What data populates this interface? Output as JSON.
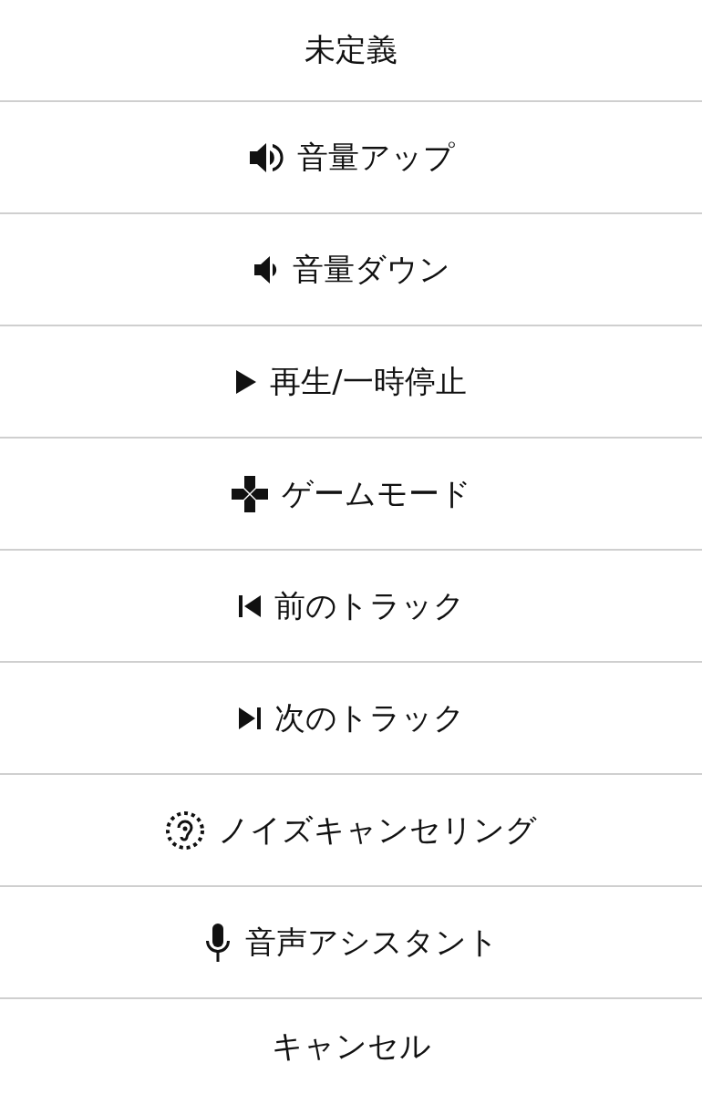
{
  "menu": {
    "items": [
      {
        "label": "未定義",
        "kind": "plain"
      },
      {
        "label": "音量アップ",
        "kind": "volume-up"
      },
      {
        "label": "音量ダウン",
        "kind": "volume-down"
      },
      {
        "label": "再生/一時停止",
        "kind": "play"
      },
      {
        "label": "ゲームモード",
        "kind": "game"
      },
      {
        "label": "前のトラック",
        "kind": "previous"
      },
      {
        "label": "次のトラック",
        "kind": "next"
      },
      {
        "label": "ノイズキャンセリング",
        "kind": "noise"
      },
      {
        "label": "音声アシスタント",
        "kind": "mic"
      },
      {
        "label": "キャンセル",
        "kind": "plain"
      }
    ]
  }
}
